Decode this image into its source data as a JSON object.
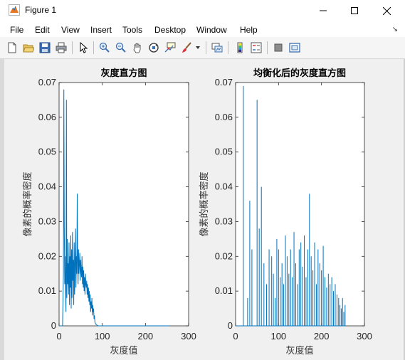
{
  "window": {
    "title": "Figure 1",
    "minimize_icon": "minimize-icon",
    "maximize_icon": "maximize-icon",
    "close_icon": "close-icon"
  },
  "menu": {
    "items": [
      "File",
      "Edit",
      "View",
      "Insert",
      "Tools",
      "Desktop",
      "Window",
      "Help"
    ]
  },
  "toolbar": {
    "icons": [
      "new-figure-icon",
      "open-file-icon",
      "save-icon",
      "print-icon",
      "select-arrow-icon",
      "zoom-in-icon",
      "zoom-out-icon",
      "pan-hand-icon",
      "rotate-3d-icon",
      "data-cursor-icon",
      "brush-icon",
      "dropdown-arrow-icon",
      "link-plot-icon",
      "colorbar-icon",
      "legend-icon",
      "hide-plot-tools-icon",
      "show-plot-tools-icon"
    ]
  },
  "colors": {
    "line": "#0072bd",
    "axes_background": "#ffffff",
    "figure_background": "#f0f0f0"
  },
  "chart_data": [
    {
      "type": "line",
      "title": "灰度直方图",
      "xlabel": "灰度值",
      "ylabel": "像素的概率密度",
      "xlim": [
        0,
        300
      ],
      "ylim": [
        0,
        0.07
      ],
      "xticks": [
        "0",
        "100",
        "200",
        "300"
      ],
      "yticks": [
        "0",
        "0.01",
        "0.02",
        "0.03",
        "0.04",
        "0.05",
        "0.06",
        "0.07"
      ],
      "x": [
        0,
        8,
        10,
        11,
        12,
        13,
        14,
        15,
        16,
        17,
        18,
        19,
        20,
        21,
        22,
        23,
        24,
        25,
        26,
        27,
        28,
        29,
        30,
        31,
        32,
        33,
        34,
        35,
        36,
        37,
        38,
        39,
        40,
        41,
        42,
        43,
        44,
        45,
        46,
        47,
        48,
        49,
        50,
        51,
        52,
        53,
        54,
        55,
        56,
        57,
        58,
        59,
        60,
        61,
        62,
        63,
        64,
        65,
        66,
        67,
        68,
        69,
        70,
        71,
        72,
        73,
        74,
        75,
        76,
        77,
        78,
        79,
        80,
        81,
        82,
        83,
        85,
        90,
        255
      ],
      "y": [
        0,
        0,
        0.015,
        0.068,
        0.03,
        0.012,
        0.02,
        0.01,
        0.004,
        0.065,
        0.008,
        0.025,
        0.012,
        0.018,
        0.009,
        0.024,
        0.006,
        0.02,
        0.011,
        0.026,
        0.005,
        0.022,
        0.008,
        0.027,
        0.013,
        0.019,
        0.006,
        0.024,
        0.009,
        0.017,
        0.028,
        0.011,
        0.02,
        0.015,
        0.038,
        0.018,
        0.012,
        0.022,
        0.015,
        0.018,
        0.021,
        0.013,
        0.019,
        0.016,
        0.014,
        0.02,
        0.012,
        0.017,
        0.011,
        0.016,
        0.01,
        0.014,
        0.009,
        0.015,
        0.012,
        0.011,
        0.013,
        0.009,
        0.012,
        0.008,
        0.011,
        0.007,
        0.01,
        0.006,
        0.009,
        0.004,
        0.007,
        0.005,
        0.008,
        0.003,
        0.006,
        0.004,
        0.005,
        0.002,
        0.003,
        0.001,
        0.0005,
        0,
        0
      ]
    },
    {
      "type": "line",
      "title": "均衡化后的灰度直方图",
      "xlabel": "灰度值",
      "ylabel": "像素的概率密度",
      "xlim": [
        0,
        300
      ],
      "ylim": [
        0,
        0.07
      ],
      "xticks": [
        "0",
        "100",
        "200",
        "300"
      ],
      "yticks": [
        "0",
        "0.01",
        "0.02",
        "0.03",
        "0.04",
        "0.05",
        "0.06",
        "0.07"
      ],
      "spikes": {
        "x": [
          18,
          28,
          33,
          38,
          50,
          55,
          60,
          66,
          72,
          78,
          84,
          88,
          92,
          96,
          100,
          104,
          108,
          112,
          116,
          120,
          124,
          128,
          132,
          136,
          140,
          144,
          148,
          152,
          156,
          160,
          164,
          168,
          172,
          176,
          180,
          184,
          188,
          192,
          196,
          200,
          204,
          208,
          212,
          216,
          220,
          224,
          228,
          232,
          236,
          240,
          243,
          246,
          249,
          252,
          255
        ],
        "y": [
          0.069,
          0.008,
          0.036,
          0.022,
          0.065,
          0.028,
          0.04,
          0.018,
          0.012,
          0.022,
          0.02,
          0.015,
          0.008,
          0.025,
          0.022,
          0.014,
          0.018,
          0.012,
          0.026,
          0.02,
          0.015,
          0.022,
          0.014,
          0.027,
          0.018,
          0.012,
          0.022,
          0.024,
          0.017,
          0.026,
          0.014,
          0.022,
          0.038,
          0.02,
          0.016,
          0.024,
          0.012,
          0.022,
          0.018,
          0.016,
          0.023,
          0.014,
          0.011,
          0.015,
          0.012,
          0.014,
          0.01,
          0.012,
          0.009,
          0.008,
          0.006,
          0.005,
          0.008,
          0.004,
          0.006
        ]
      }
    }
  ]
}
